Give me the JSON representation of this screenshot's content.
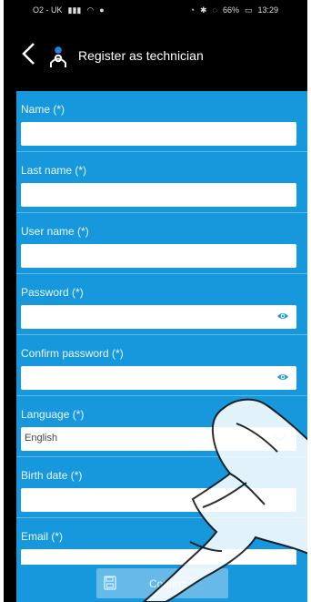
{
  "status": {
    "carrier": "O2 - UK",
    "battery": "66%",
    "time": "13:29"
  },
  "header": {
    "title": "Register as technician"
  },
  "form": {
    "fields": [
      {
        "label": "Name (*)",
        "value": ""
      },
      {
        "label": "Last name (*)",
        "value": ""
      },
      {
        "label": "User name (*)",
        "value": ""
      },
      {
        "label": "Password (*)",
        "value": ""
      },
      {
        "label": "Confirm password (*)",
        "value": ""
      },
      {
        "label": "Language (*)",
        "value": "English"
      },
      {
        "label": "Birth date (*)",
        "value": ""
      },
      {
        "label": "Email (*)",
        "value": ""
      }
    ]
  },
  "footer": {
    "confirm_label": "Confirm"
  },
  "colors": {
    "accent": "#1798dc",
    "button": "#67b9e8"
  },
  "icons": [
    "back-arrow-icon",
    "technician-user-icon",
    "eye-icon",
    "chevron-down-icon",
    "save-icon"
  ]
}
